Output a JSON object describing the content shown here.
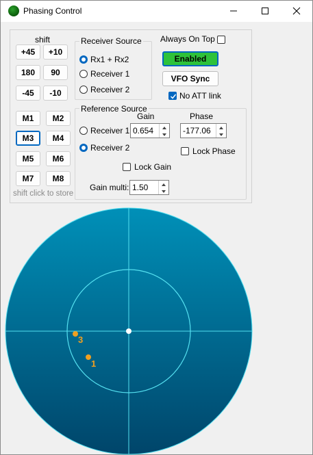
{
  "window": {
    "title": "Phasing Control",
    "buttons": [
      "minimize",
      "maximize",
      "close"
    ]
  },
  "shift": {
    "label": "shift",
    "buttons": [
      "+45",
      "+10",
      "180",
      "90",
      "-45",
      "-10"
    ],
    "hint": "shift click to store"
  },
  "memory": {
    "buttons": [
      "M1",
      "M2",
      "M3",
      "M4",
      "M5",
      "M6",
      "M7",
      "M8"
    ],
    "focused": "M3"
  },
  "receiver_source": {
    "title": "Receiver Source",
    "options": [
      "Rx1 + Rx2",
      "Receiver 1",
      "Receiver 2"
    ],
    "selected": "Rx1 + Rx2"
  },
  "options": {
    "always_on_top_label": "Always On Top",
    "always_on_top": false,
    "enabled_label": "Enabled",
    "enabled_color": "#2ec23a",
    "vfo_sync_label": "VFO Sync",
    "no_att_link_label": "No ATT link",
    "no_att_link": true
  },
  "reference_source": {
    "title": "Reference Source",
    "gain_header": "Gain",
    "phase_header": "Phase",
    "options": [
      "Receiver 1",
      "Receiver 2"
    ],
    "selected": "Receiver 2",
    "gain_value": "0.654",
    "phase_value": "-177.06",
    "lock_phase_label": "Lock Phase",
    "lock_phase": false,
    "lock_gain_label": "Lock Gain",
    "lock_gain": false,
    "gain_multi_label": "Gain multi:",
    "gain_multi_value": "1.50"
  },
  "scope": {
    "points": [
      {
        "label": "3",
        "color": "#f0a020"
      },
      {
        "label": "1",
        "color": "#f0a020"
      }
    ],
    "outer_color": "#0090b8",
    "inner_color": "#00456a",
    "ring_color": "#55e0f0"
  }
}
